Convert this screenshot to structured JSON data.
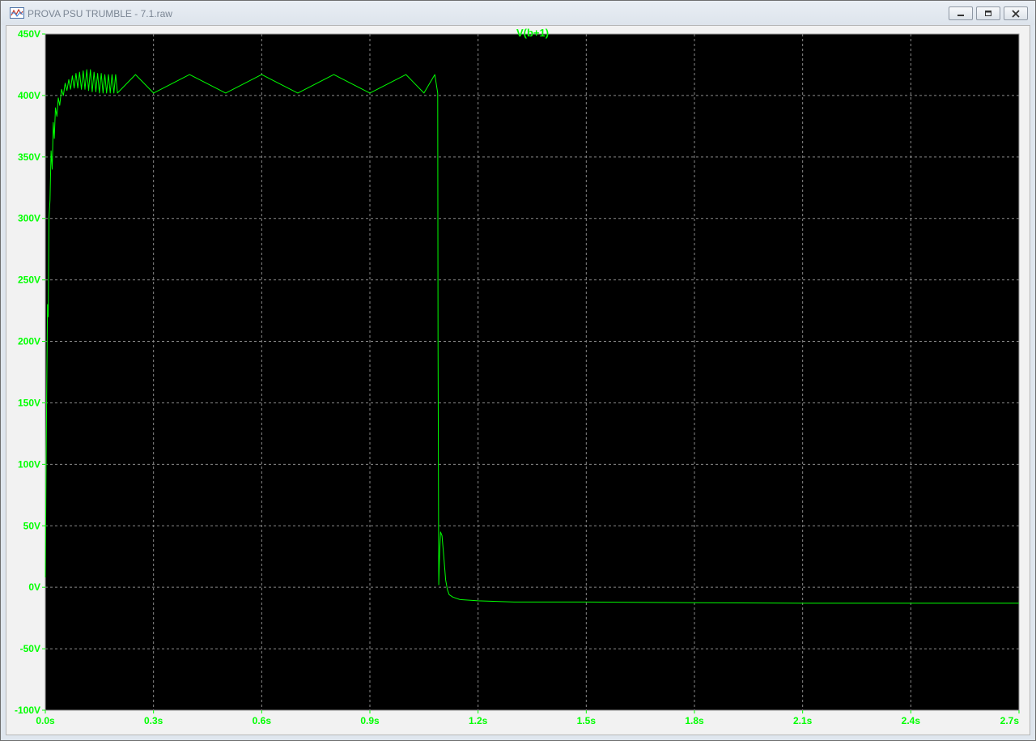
{
  "window": {
    "title": "PROVA PSU TRUMBLE - 7.1.raw",
    "icons": {
      "app": "waveform-app-icon",
      "minimize": "minimize-icon",
      "maximize": "maximize-icon",
      "close": "close-icon"
    }
  },
  "colors": {
    "trace": "#00ff00",
    "plot_bg": "#000000",
    "grid": "#8a8a8a",
    "frame": "#f0f0f0"
  },
  "chart_data": {
    "type": "line",
    "title": "",
    "xlabel": "",
    "ylabel": "",
    "xlim": [
      0,
      2.7
    ],
    "ylim": [
      -100,
      450
    ],
    "grid": true,
    "x_ticks": [
      {
        "value": 0.0,
        "label": "0.0s"
      },
      {
        "value": 0.3,
        "label": "0.3s"
      },
      {
        "value": 0.6,
        "label": "0.6s"
      },
      {
        "value": 0.9,
        "label": "0.9s"
      },
      {
        "value": 1.2,
        "label": "1.2s"
      },
      {
        "value": 1.5,
        "label": "1.5s"
      },
      {
        "value": 1.8,
        "label": "1.8s"
      },
      {
        "value": 2.1,
        "label": "2.1s"
      },
      {
        "value": 2.4,
        "label": "2.4s"
      },
      {
        "value": 2.7,
        "label": "2.7s"
      }
    ],
    "y_ticks": [
      {
        "value": 450,
        "label": "450V"
      },
      {
        "value": 400,
        "label": "400V"
      },
      {
        "value": 350,
        "label": "350V"
      },
      {
        "value": 300,
        "label": "300V"
      },
      {
        "value": 250,
        "label": "250V"
      },
      {
        "value": 200,
        "label": "200V"
      },
      {
        "value": 150,
        "label": "150V"
      },
      {
        "value": 100,
        "label": "100V"
      },
      {
        "value": 50,
        "label": "50V"
      },
      {
        "value": 0,
        "label": "0V"
      },
      {
        "value": -50,
        "label": "-50V"
      },
      {
        "value": -100,
        "label": "-100V"
      }
    ],
    "series": [
      {
        "name": "V(b+1)",
        "color": "#00ff00",
        "x": [
          0.0,
          0.002,
          0.004,
          0.006,
          0.008,
          0.01,
          0.013,
          0.016,
          0.019,
          0.022,
          0.025,
          0.028,
          0.032,
          0.036,
          0.04,
          0.045,
          0.05,
          0.055,
          0.06,
          0.065,
          0.07,
          0.075,
          0.08,
          0.085,
          0.09,
          0.095,
          0.1,
          0.105,
          0.11,
          0.115,
          0.12,
          0.125,
          0.13,
          0.135,
          0.14,
          0.145,
          0.15,
          0.155,
          0.16,
          0.165,
          0.17,
          0.175,
          0.18,
          0.185,
          0.19,
          0.195,
          0.2,
          0.25,
          0.3,
          0.4,
          0.5,
          0.6,
          0.7,
          0.8,
          0.9,
          1.0,
          1.05,
          1.08,
          1.088,
          1.089,
          1.091,
          1.093,
          1.096,
          1.1,
          1.105,
          1.11,
          1.115,
          1.12,
          1.13,
          1.15,
          1.2,
          1.3,
          1.5,
          1.8,
          2.1,
          2.4,
          2.7
        ],
        "y": [
          8,
          95,
          165,
          230,
          220,
          300,
          315,
          355,
          340,
          378,
          365,
          390,
          383,
          398,
          392,
          405,
          400,
          410,
          404,
          413,
          405,
          416,
          406,
          418,
          406,
          419,
          405,
          420,
          405,
          421,
          404,
          421,
          403,
          419,
          403,
          418,
          402,
          418,
          402,
          417,
          402,
          417,
          402,
          417,
          402,
          417,
          402,
          417,
          402,
          417,
          402,
          417,
          402,
          417,
          402,
          417,
          402,
          417,
          402,
          200,
          2,
          25,
          45,
          42,
          25,
          6,
          -2,
          -6,
          -8,
          -10,
          -11,
          -12,
          -12,
          -12.5,
          -13,
          -13,
          -13
        ]
      }
    ]
  }
}
